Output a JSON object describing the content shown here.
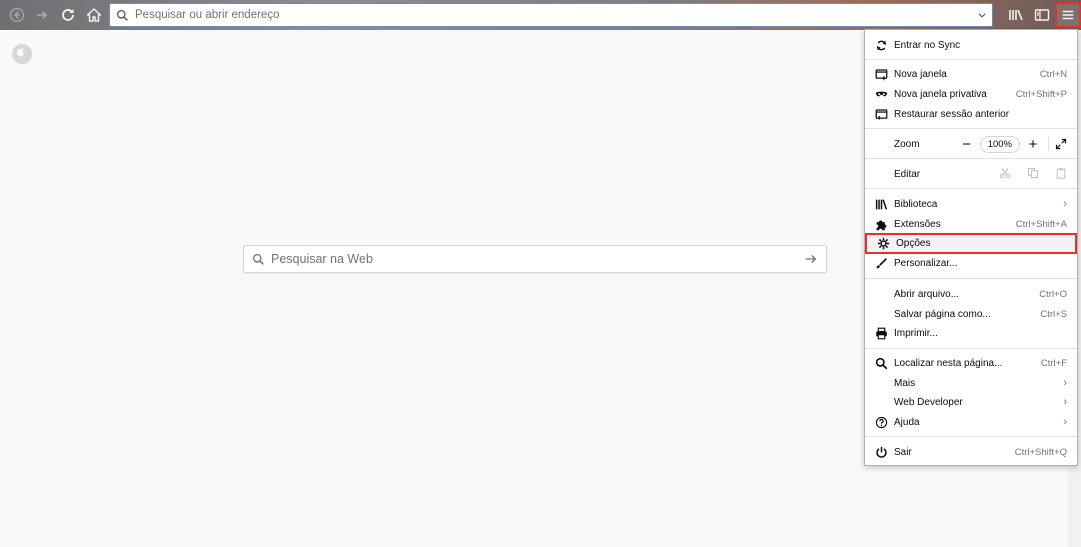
{
  "toolbar": {
    "url_placeholder": "Pesquisar ou abrir endereço",
    "icons": [
      "back-icon",
      "forward-icon",
      "reload-icon",
      "home-icon",
      "search-icon",
      "dropdown-icon",
      "library-icon",
      "sidebar-icon",
      "hamburger-menu-icon"
    ]
  },
  "newtab": {
    "search_placeholder": "Pesquisar na Web"
  },
  "menu": {
    "sync": "Entrar no Sync",
    "new_window": "Nova janela",
    "new_window_sc": "Ctrl+N",
    "private_window": "Nova janela privativa",
    "private_window_sc": "Ctrl+Shift+P",
    "restore_session": "Restaurar sessão anterior",
    "zoom": "Zoom",
    "zoom_value": "100%",
    "edit": "Editar",
    "library": "Biblioteca",
    "addons": "Extensões",
    "addons_sc": "Ctrl+Shift+A",
    "options": "Opções",
    "customize": "Personalizar...",
    "open_file": "Abrir arquivo...",
    "open_file_sc": "Ctrl+O",
    "save_page": "Salvar página como...",
    "save_page_sc": "Ctrl+S",
    "print": "Imprimir...",
    "find": "Localizar nesta página...",
    "find_sc": "Ctrl+F",
    "more": "Mais",
    "web_developer": "Web Developer",
    "help": "Ajuda",
    "quit": "Sair",
    "quit_sc": "Ctrl+Shift+Q"
  },
  "colors": {
    "highlight_border": "#e0342a"
  }
}
